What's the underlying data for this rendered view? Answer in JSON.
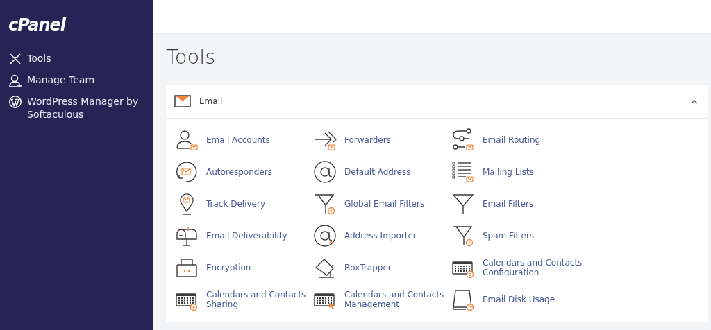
{
  "sidebar": {
    "logo": "cPanel",
    "items": [
      {
        "label": "Tools",
        "selected": false
      },
      {
        "label": "Manage Team",
        "selected": false
      },
      {
        "label": "WordPress Manager by Softaculous",
        "selected": false
      }
    ]
  },
  "page": {
    "title": "Tools"
  },
  "section": {
    "title": "Email",
    "expanded": true,
    "items": [
      {
        "label": "Email Accounts"
      },
      {
        "label": "Forwarders"
      },
      {
        "label": "Email Routing"
      },
      {
        "label": "Autoresponders"
      },
      {
        "label": "Default Address"
      },
      {
        "label": "Mailing Lists"
      },
      {
        "label": "Track Delivery"
      },
      {
        "label": "Global Email Filters"
      },
      {
        "label": "Email Filters"
      },
      {
        "label": "Email Deliverability"
      },
      {
        "label": "Address Importer"
      },
      {
        "label": "Spam Filters"
      },
      {
        "label": "Encryption"
      },
      {
        "label": "BoxTrapper"
      },
      {
        "label": "Calendars and Contacts Configuration"
      },
      {
        "label": "Calendars and Contacts Sharing"
      },
      {
        "label": "Calendars and Contacts Management"
      },
      {
        "label": "Email Disk Usage"
      }
    ]
  }
}
